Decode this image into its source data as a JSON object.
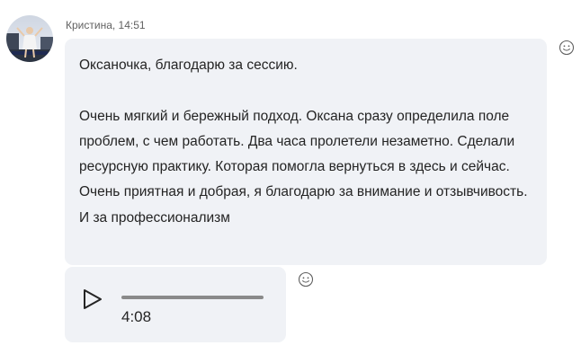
{
  "message": {
    "sender": "Кристина, 14:51",
    "text_paragraphs": [
      "Оксаночка, благодарю за сессию.",
      "Очень мягкий и бережный подход. Оксана сразу определила поле проблем, с чем работать. Два часа пролетели незаметно. Сделали ресурсную практику. Которая помогла вернуться в здесь и сейчас. Очень приятная и добрая, я благодарю за внимание и отзывчивость. И за профессионализм"
    ],
    "reaction_icon": "smiley-icon"
  },
  "voice_message": {
    "duration": "4:08",
    "play_icon": "play-icon",
    "progress_played": 0,
    "reaction_icon": "smiley-icon"
  },
  "colors": {
    "bubble_background": "#f0f2f6",
    "text": "#242424",
    "meta_text": "#616161",
    "progress_track": "#8a8a8a"
  }
}
